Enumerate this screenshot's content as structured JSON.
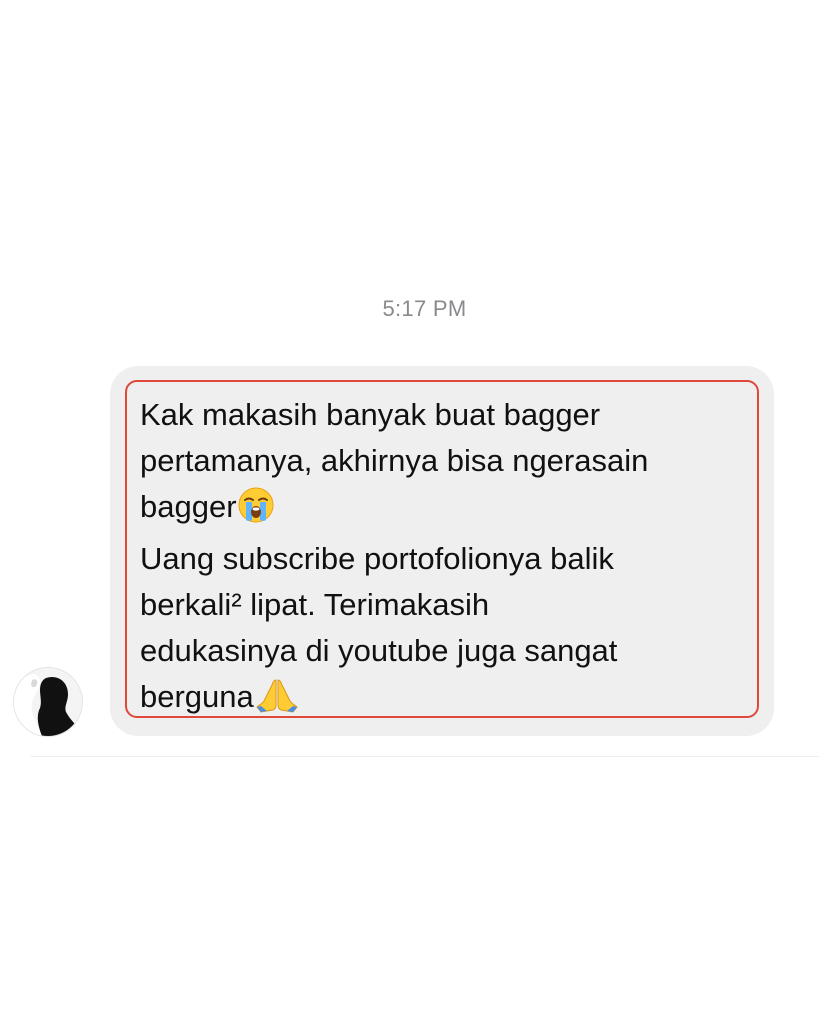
{
  "chat": {
    "timestamp": "5:17 PM",
    "message": {
      "lines": [
        "Kak makasih banyak buat bagger",
        "pertamanya, akhirnya bisa ngerasain",
        "bagger",
        "Uang subscribe portofolionya balik",
        "berkali² lipat. Terimakasih",
        "edukasinya di youtube juga sangat",
        "berguna"
      ],
      "emojis": [
        "loudly-crying-face-icon",
        "folded-hands-icon"
      ],
      "highlight_color": "#e0483a",
      "bubble_color": "#efefef"
    },
    "sender": {
      "avatar": "silhouette-avatar-icon"
    }
  }
}
